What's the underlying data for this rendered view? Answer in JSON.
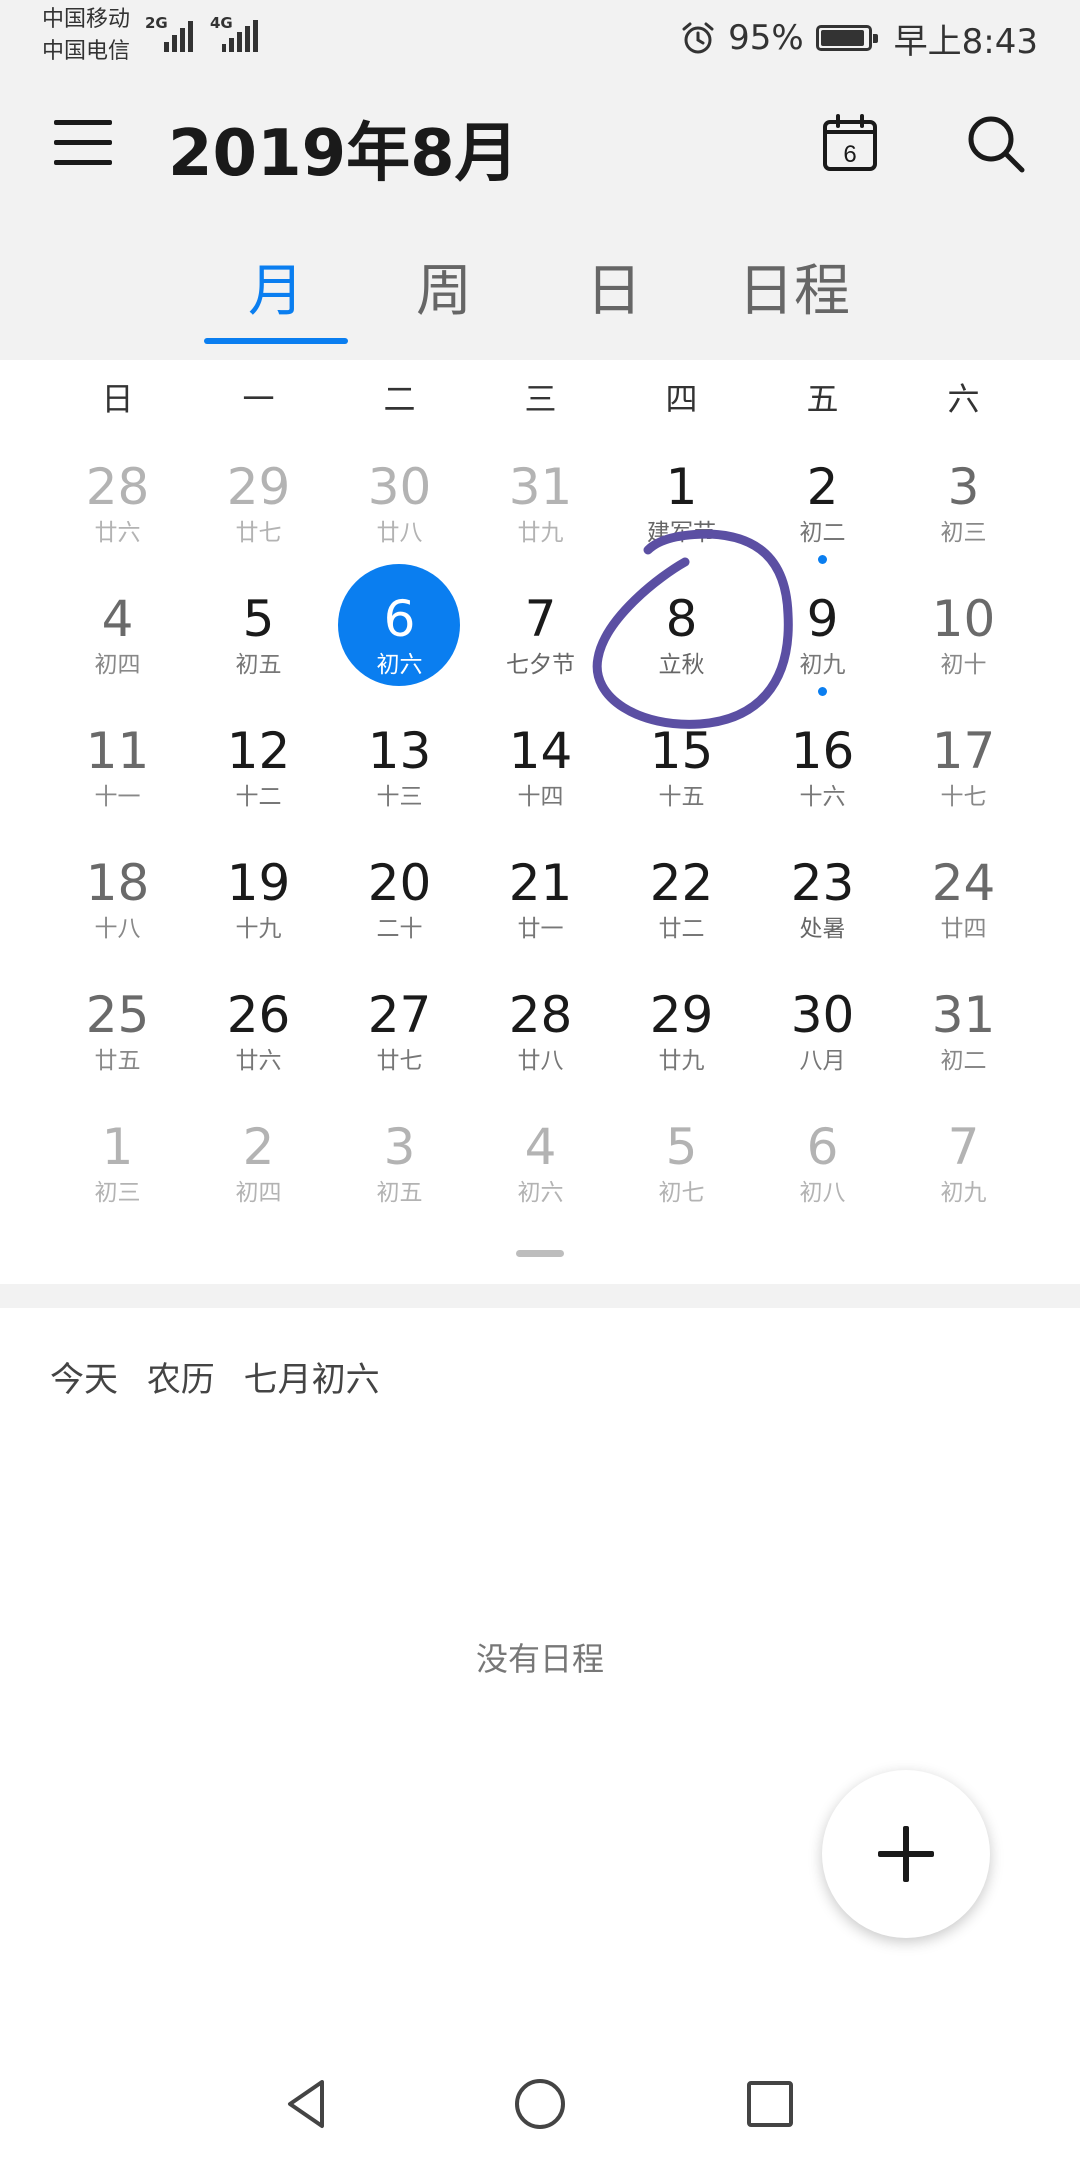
{
  "status_bar": {
    "carrier1": "中国移动",
    "carrier2": "中国电信",
    "net1": "2G",
    "net2": "4G",
    "battery_text": "95%",
    "battery_level": 0.95,
    "time": "早上8:43",
    "icons": [
      "signal-icon",
      "alarm-icon",
      "battery-icon"
    ]
  },
  "header": {
    "title": "2019年8月",
    "today_icon_day": "6",
    "icons": [
      "menu-icon",
      "today-calendar-icon",
      "search-icon"
    ]
  },
  "tabs": [
    {
      "label": "月",
      "active": true
    },
    {
      "label": "周",
      "active": false
    },
    {
      "label": "日",
      "active": false
    },
    {
      "label": "日程",
      "active": false
    }
  ],
  "weekdays": [
    "日",
    "一",
    "二",
    "三",
    "四",
    "五",
    "六"
  ],
  "calendar": {
    "accent": "#0a7ef0",
    "weeks": [
      [
        {
          "day": "28",
          "lunar": "廿六",
          "other": true
        },
        {
          "day": "29",
          "lunar": "廿七",
          "other": true
        },
        {
          "day": "30",
          "lunar": "廿八",
          "other": true
        },
        {
          "day": "31",
          "lunar": "廿九",
          "other": true
        },
        {
          "day": "1",
          "lunar": "建军节",
          "holiday": true
        },
        {
          "day": "2",
          "lunar": "初二",
          "dot": true
        },
        {
          "day": "3",
          "lunar": "初三"
        }
      ],
      [
        {
          "day": "4",
          "lunar": "初四"
        },
        {
          "day": "5",
          "lunar": "初五"
        },
        {
          "day": "6",
          "lunar": "初六",
          "selected": true
        },
        {
          "day": "7",
          "lunar": "七夕节",
          "holiday": true
        },
        {
          "day": "8",
          "lunar": "立秋",
          "holiday": true
        },
        {
          "day": "9",
          "lunar": "初九",
          "dot": true
        },
        {
          "day": "10",
          "lunar": "初十"
        }
      ],
      [
        {
          "day": "11",
          "lunar": "十一"
        },
        {
          "day": "12",
          "lunar": "十二"
        },
        {
          "day": "13",
          "lunar": "十三"
        },
        {
          "day": "14",
          "lunar": "十四"
        },
        {
          "day": "15",
          "lunar": "十五"
        },
        {
          "day": "16",
          "lunar": "十六"
        },
        {
          "day": "17",
          "lunar": "十七"
        }
      ],
      [
        {
          "day": "18",
          "lunar": "十八"
        },
        {
          "day": "19",
          "lunar": "十九"
        },
        {
          "day": "20",
          "lunar": "二十"
        },
        {
          "day": "21",
          "lunar": "廿一"
        },
        {
          "day": "22",
          "lunar": "廿二"
        },
        {
          "day": "23",
          "lunar": "处暑",
          "holiday": true
        },
        {
          "day": "24",
          "lunar": "廿四"
        }
      ],
      [
        {
          "day": "25",
          "lunar": "廿五"
        },
        {
          "day": "26",
          "lunar": "廿六"
        },
        {
          "day": "27",
          "lunar": "廿七"
        },
        {
          "day": "28",
          "lunar": "廿八"
        },
        {
          "day": "29",
          "lunar": "廿九"
        },
        {
          "day": "30",
          "lunar": "八月"
        },
        {
          "day": "31",
          "lunar": "初二"
        }
      ],
      [
        {
          "day": "1",
          "lunar": "初三",
          "other": true
        },
        {
          "day": "2",
          "lunar": "初四",
          "other": true
        },
        {
          "day": "3",
          "lunar": "初五",
          "other": true
        },
        {
          "day": "4",
          "lunar": "初六",
          "other": true
        },
        {
          "day": "5",
          "lunar": "初七",
          "other": true
        },
        {
          "day": "6",
          "lunar": "初八",
          "other": true
        },
        {
          "day": "7",
          "lunar": "初九",
          "other": true
        }
      ]
    ]
  },
  "agenda": {
    "today_label": "今天",
    "lunar_label": "农历",
    "lunar_date": "七月初六",
    "empty_text": "没有日程"
  },
  "annotation": {
    "color": "#5b4fa3"
  },
  "fab": {
    "icon": "plus-icon"
  },
  "nav_bar": {
    "icons": [
      "back-icon",
      "home-icon",
      "recents-icon"
    ]
  }
}
